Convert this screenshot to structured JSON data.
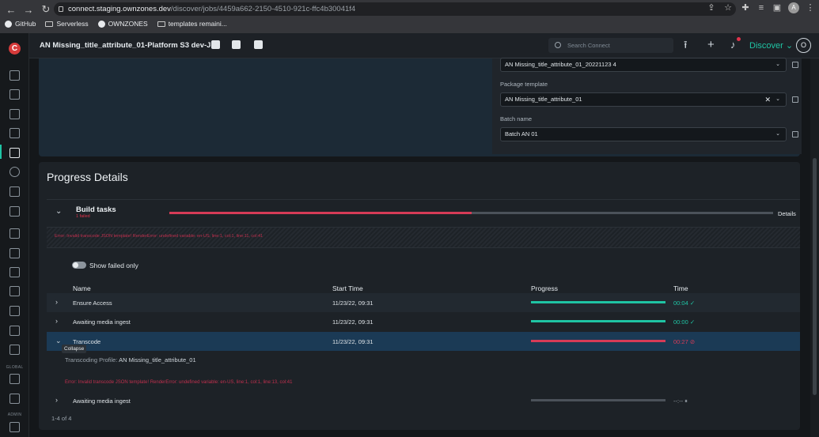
{
  "browser": {
    "url_host": "connect.staging.ownzones.dev",
    "url_path": "/discover/jobs/4459a662-2150-4510-921c-ffc4b30041f4",
    "profile_initial": "A",
    "bookmarks": [
      {
        "label": "GitHub",
        "icon": "github-icon"
      },
      {
        "label": "Serverless",
        "icon": "folder-icon"
      },
      {
        "label": "OWNZONES",
        "icon": "github-icon"
      },
      {
        "label": "templates remaini...",
        "icon": "folder-icon"
      }
    ]
  },
  "header": {
    "job_title": "AN Missing_title_attribute_01-Platform S3 dev-Job",
    "search_placeholder": "Search Connect",
    "discover_label": "Discover",
    "user_initial": "O"
  },
  "sidebar": {
    "global_label": "GLOBAL",
    "admin_label": "ADMIN"
  },
  "form": {
    "field1_value": "AN Missing_title_attribute_01_20221123 4",
    "package_template_label": "Package template",
    "package_template_value": "AN Missing_title_attribute_01",
    "batch_name_label": "Batch name",
    "batch_name_value": "Batch AN 01"
  },
  "progress": {
    "title": "Progress Details",
    "build_title": "Build tasks",
    "build_failed": "1 failed",
    "build_progress": 0.5,
    "details_label": "Details",
    "error_text": "Error: Invalid transcode JSON template! RenderError: undefined variable: en-US, line:1, col:1, line:11, col:41",
    "toggle_label": "Show failed only",
    "columns": {
      "name": "Name",
      "start": "Start Time",
      "progress": "Progress",
      "time": "Time"
    },
    "rows": [
      {
        "name": "Ensure Access",
        "start": "11/23/22, 09:31",
        "progress": 1.0,
        "color": "#1fc4a4",
        "time": "00:04 ✓",
        "time_color": "#1fc4a4"
      },
      {
        "name": "Awaiting media ingest",
        "start": "11/23/22, 09:31",
        "progress": 1.0,
        "color": "#1fc4a4",
        "time": "00:00 ✓",
        "time_color": "#1fc4a4"
      },
      {
        "name": "Transcode",
        "start": "11/23/22, 09:31",
        "progress": 1.0,
        "color": "#d63b57",
        "time": "00:27 ⊘",
        "time_color": "#d63b57"
      },
      {
        "name": "Awaiting media ingest",
        "start": "",
        "progress": 0.0,
        "color": "#4b525a",
        "time": "--:-- ⏸",
        "time_color": "#9aa3ab"
      }
    ],
    "collapse_tooltip": "Collapse",
    "transcoding_profile_label": "Transcoding Profile:",
    "transcoding_profile_value": "AN Missing_title_attribute_01",
    "transcode_error": "Error: Invalid transcode JSON template! RenderError: undefined variable: en-US, line:1, col:1, line:13, col:41",
    "pager": "1-4 of 4"
  }
}
